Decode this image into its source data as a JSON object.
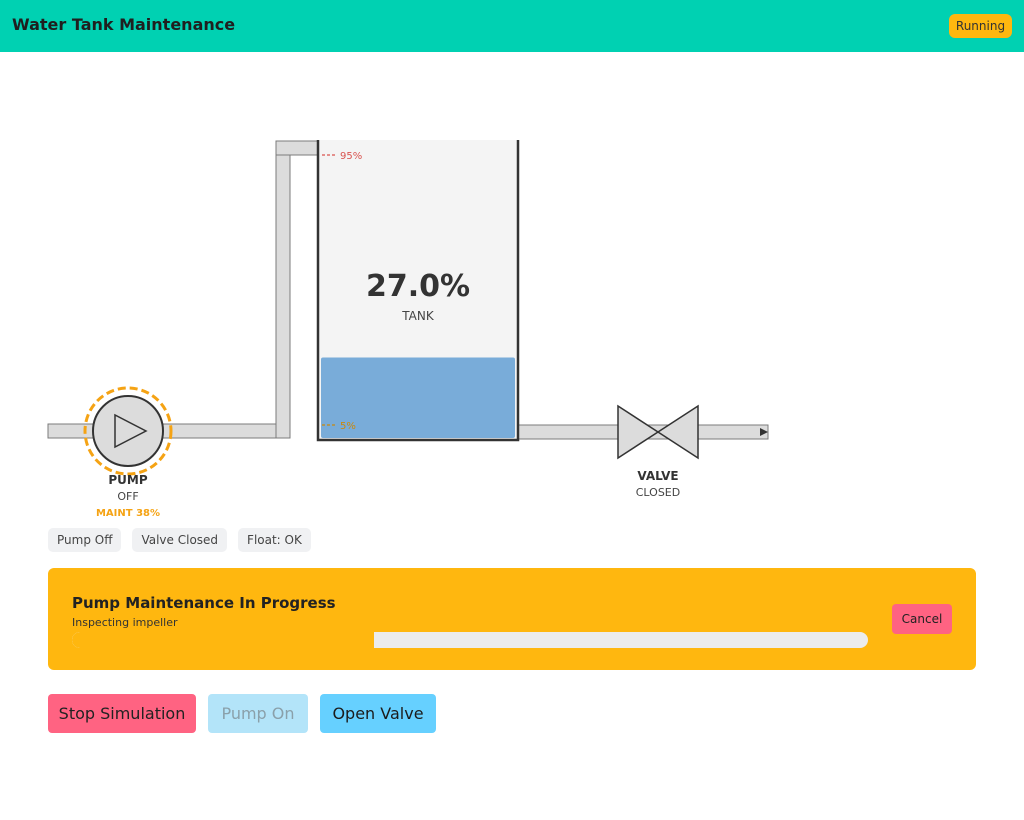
{
  "header": {
    "title": "Water Tank Maintenance",
    "status": "Running"
  },
  "tank": {
    "level_text": "27.0%",
    "level_fraction": 0.27,
    "label": "TANK",
    "high_mark": "95%",
    "low_mark": "5%"
  },
  "pump": {
    "label": "PUMP",
    "state": "OFF",
    "maint": "MAINT 38%"
  },
  "valve": {
    "label": "VALVE",
    "state": "CLOSED"
  },
  "chips": [
    "Pump Off",
    "Valve Closed",
    "Float: OK"
  ],
  "maintenance": {
    "title": "Pump Maintenance In Progress",
    "step": "Inspecting impeller",
    "progress": 0.38,
    "cancel_label": "Cancel"
  },
  "actions": {
    "stop": "Stop Simulation",
    "pump_on": "Pump On",
    "open_valve": "Open Valve"
  },
  "colors": {
    "accent": "#00d1b2",
    "warning": "#ffb70f",
    "danger": "#ff6382",
    "info": "#66d0ff",
    "water": "#79acd9"
  },
  "icons": {
    "pump": "play-triangle-icon",
    "valve": "bowtie-valve-icon",
    "outlet": "flow-arrow-icon"
  }
}
